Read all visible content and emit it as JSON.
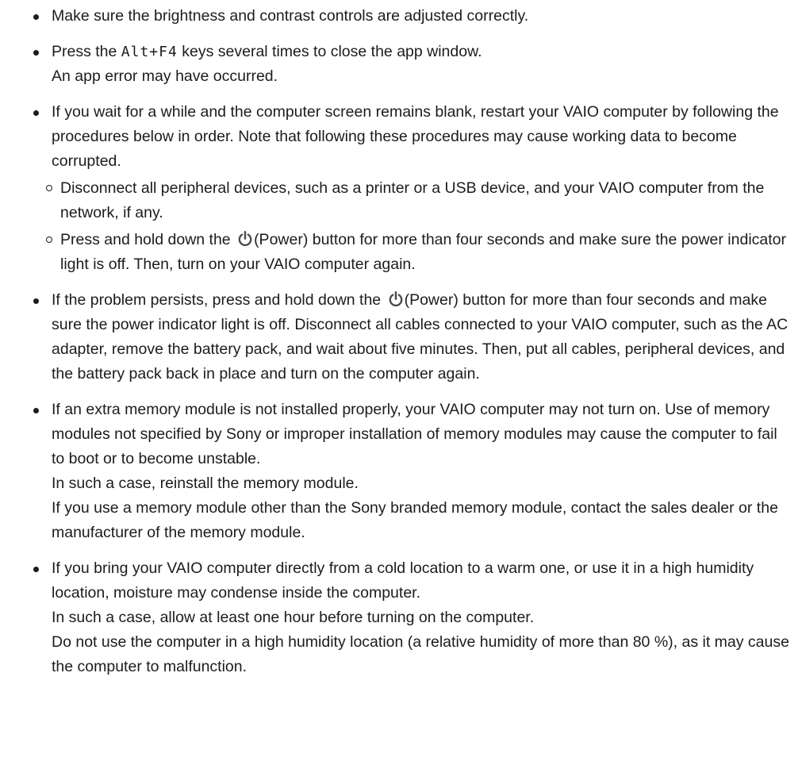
{
  "items": [
    {
      "text": "Make sure the brightness and contrast controls are adjusted correctly."
    },
    {
      "prefix": "Press the ",
      "key": "Alt+F4",
      "suffix": " keys several times to close the app window.",
      "line2": "An app error may have occurred."
    },
    {
      "text": "If you wait for a while and the computer screen remains blank, restart your VAIO computer by following the procedures below in order. Note that following these procedures may cause working data to become corrupted.",
      "sub": [
        {
          "text": "Disconnect all peripheral devices, such as a printer or a USB device, and your VAIO computer from the network, if any."
        },
        {
          "prefix": "Press and hold down the ",
          "label": "(Power)",
          "suffix": " button for more than four seconds and make sure the power indicator light is off. Then, turn on your VAIO computer again."
        }
      ]
    },
    {
      "prefix": "If the problem persists, press and hold down the ",
      "label": "(Power)",
      "suffix": " button for more than four seconds and make sure the power indicator light is off. Disconnect all cables connected to your VAIO computer, such as the AC adapter, remove the battery pack, and wait about five minutes. Then, put all cables, peripheral devices, and the battery pack back in place and turn on the computer again."
    },
    {
      "line1": "If an extra memory module is not installed properly, your VAIO computer may not turn on. Use of memory modules not specified by Sony or improper installation of memory modules may cause the computer to fail to boot or to become unstable.",
      "line2": "In such a case, reinstall the memory module.",
      "line3": "If you use a memory module other than the Sony branded memory module, contact the sales dealer or the manufacturer of the memory module."
    },
    {
      "line1": "If you bring your VAIO computer directly from a cold location to a warm one, or use it in a high humidity location, moisture may condense inside the computer.",
      "line2": "In such a case, allow at least one hour before turning on the computer.",
      "line3": "Do not use the computer in a high humidity location (a relative humidity of more than 80 %), as it may cause the computer to malfunction."
    }
  ],
  "icons": {
    "power": "power-icon"
  }
}
